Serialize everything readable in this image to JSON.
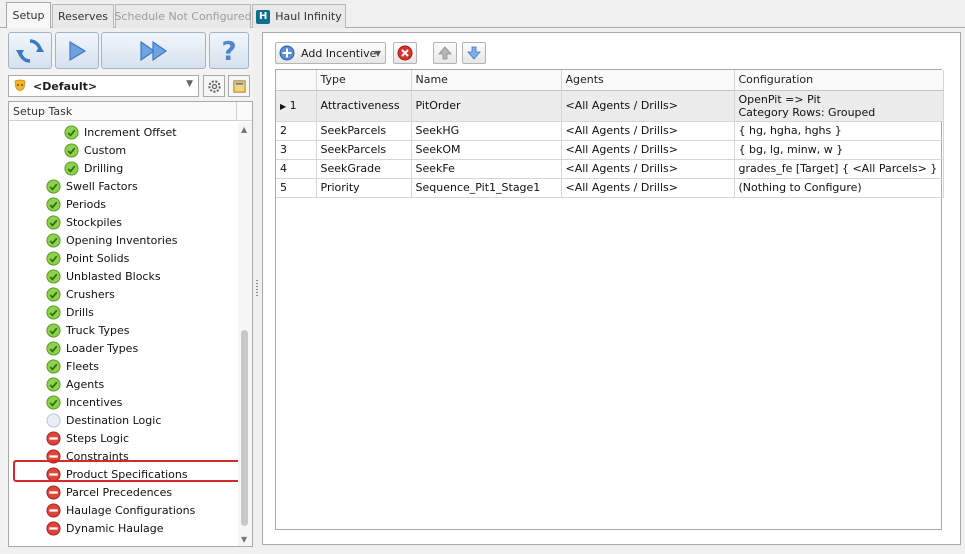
{
  "tabs": [
    {
      "label": "Setup",
      "state": "active"
    },
    {
      "label": "Reserves",
      "state": "normal"
    },
    {
      "label": "Schedule Not Configured",
      "state": "disabled"
    },
    {
      "label": "Haul Infinity",
      "state": "normal",
      "icon": "haul-infinity-icon"
    }
  ],
  "profile": {
    "selected": "<Default>"
  },
  "tree": {
    "header": "Setup Task",
    "items": [
      {
        "label": "Increment Offset",
        "status": "ok"
      },
      {
        "label": "Custom",
        "status": "ok"
      },
      {
        "label": "Drilling",
        "status": "ok"
      },
      {
        "label": "Swell Factors",
        "status": "ok"
      },
      {
        "label": "Periods",
        "status": "ok"
      },
      {
        "label": "Stockpiles",
        "status": "ok"
      },
      {
        "label": "Opening Inventories",
        "status": "ok"
      },
      {
        "label": "Point Solids",
        "status": "ok"
      },
      {
        "label": "Unblasted Blocks",
        "status": "ok"
      },
      {
        "label": "Crushers",
        "status": "ok"
      },
      {
        "label": "Drills",
        "status": "ok"
      },
      {
        "label": "Truck Types",
        "status": "ok"
      },
      {
        "label": "Loader Types",
        "status": "ok"
      },
      {
        "label": "Fleets",
        "status": "ok"
      },
      {
        "label": "Agents",
        "status": "ok"
      },
      {
        "label": "Incentives",
        "status": "ok",
        "highlighted": true
      },
      {
        "label": "Destination Logic",
        "status": "none"
      },
      {
        "label": "Steps Logic",
        "status": "error"
      },
      {
        "label": "Constraints",
        "status": "error"
      },
      {
        "label": "Product Specifications",
        "status": "error"
      },
      {
        "label": "Parcel Precedences",
        "status": "error"
      },
      {
        "label": "Haulage Configurations",
        "status": "error"
      },
      {
        "label": "Dynamic Haulage",
        "status": "error"
      }
    ]
  },
  "toolbar": {
    "add_label": "Add Incentive"
  },
  "grid": {
    "columns": [
      "",
      "Type",
      "Name",
      "Agents",
      "Configuration"
    ],
    "rows": [
      {
        "num": "1",
        "selected": true,
        "type": "Attractiveness",
        "name": "PitOrder",
        "agents": "<All Agents / Drills>",
        "config_line1": "OpenPit => Pit",
        "config_line2": "Category Rows: Grouped"
      },
      {
        "num": "2",
        "type": "SeekParcels",
        "name": "SeekHG",
        "agents": "<All Agents / Drills>",
        "config": "{ hg, hgha, hghs }"
      },
      {
        "num": "3",
        "type": "SeekParcels",
        "name": "SeekOM",
        "agents": "<All Agents / Drills>",
        "config": "{ bg, lg, minw, w }"
      },
      {
        "num": "4",
        "type": "SeekGrade",
        "name": "SeekFe",
        "agents": "<All Agents / Drills>",
        "config": "grades_fe [Target] { <All Parcels> }"
      },
      {
        "num": "5",
        "type": "Priority",
        "name": "Sequence_Pit1_Stage1",
        "agents": "<All Agents / Drills>",
        "config": "(Nothing to Configure)"
      }
    ]
  },
  "colors": {
    "accent": "#4f7fbf",
    "ok": "#6fbf2c",
    "error": "#d9342b",
    "highlight": "#d42a2a"
  }
}
